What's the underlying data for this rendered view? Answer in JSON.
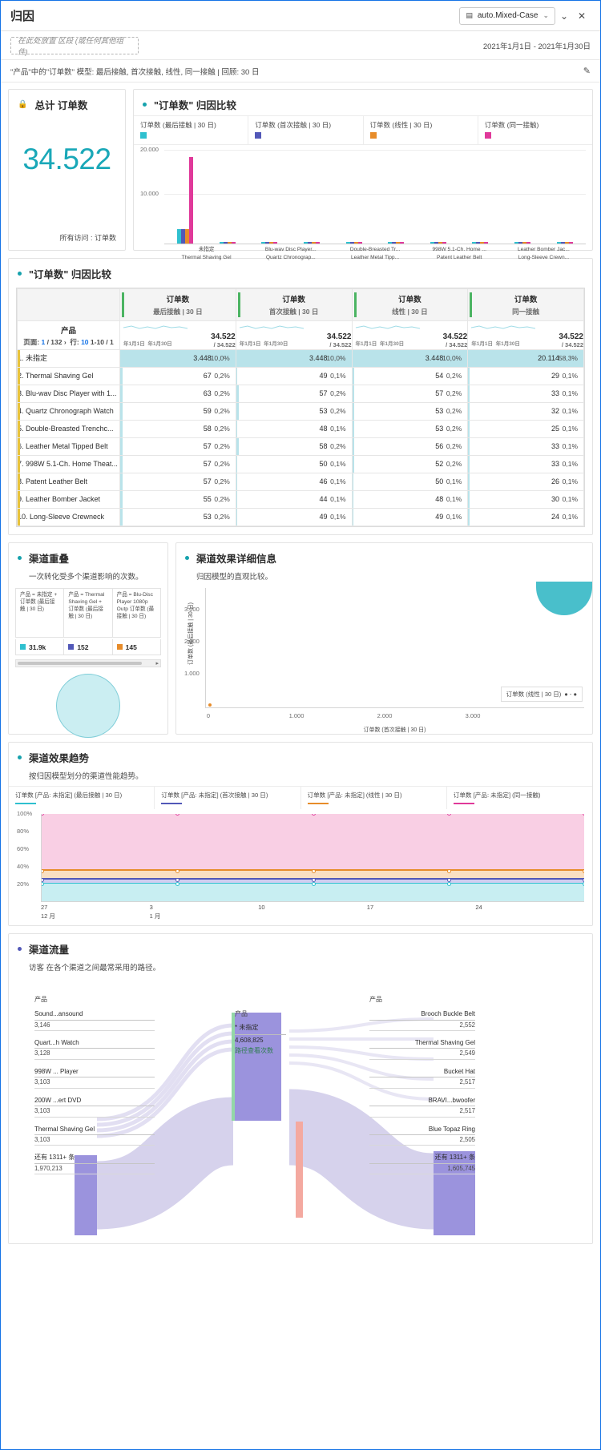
{
  "header": {
    "title": "归因",
    "report_suite": "auto.Mixed-Case",
    "db_icon": "database-icon",
    "chevron": "⌄",
    "close": "✕",
    "dropzone_placeholder": "在此处放置 区段 (或任何其他组件)",
    "date_range": "2021年1月1日 - 2021年1月30日",
    "model_line": "\"产品\"中的\"订单数\" 模型: 最后接触, 首次接触, 线性, 同一接触 | 回顾: 30 日",
    "edit_icon": "pencil-icon"
  },
  "summary": {
    "title": "总计 订单数",
    "lock_icon": "lock-icon",
    "value": "34.522",
    "footer": "所有访问 : 订单数",
    "color": "#1aa8b8"
  },
  "attribution_chart": {
    "title": "\"订单数\" 归因比较",
    "legend": [
      {
        "label": "订单数 (最后接触 | 30 日)",
        "color": "#2fc0cf"
      },
      {
        "label": "订单数 (首次接触 | 30 日)",
        "color": "#5258b8"
      },
      {
        "label": "订单数 (线性 | 30 日)",
        "color": "#e78c2a"
      },
      {
        "label": "订单数 (同一接触)",
        "color": "#e0399a"
      }
    ],
    "chart_data": {
      "type": "bar",
      "title": "\"订单数\" 归因比较",
      "ylabel": "",
      "xlabel": "",
      "ylim": [
        0,
        22000
      ],
      "yticks": [
        "10.000",
        "20.000"
      ],
      "categories": [
        "未指定",
        "Thermal Shaving Gel",
        "Blu-wav Disc Player...",
        "Quartz Chronograp...",
        "Double-Breasted Tr...",
        "Leather Metal Tipp...",
        "998W 5.1-Ch. Home ...",
        "Patent Leather Belt",
        "Leather Bomber Jac...",
        "Long-Sleeve Crewn..."
      ],
      "series": [
        {
          "name": "订单数 (最后接触 | 30 日)",
          "color": "#2fc0cf",
          "values": [
            3448,
            67,
            63,
            59,
            58,
            57,
            57,
            57,
            55,
            53
          ]
        },
        {
          "name": "订单数 (首次接触 | 30 日)",
          "color": "#5258b8",
          "values": [
            3448,
            49,
            57,
            53,
            48,
            58,
            52,
            46,
            44,
            49
          ]
        },
        {
          "name": "订单数 (线性 | 30 日)",
          "color": "#e78c2a",
          "values": [
            3448,
            54,
            57,
            53,
            53,
            56,
            50,
            50,
            48,
            49
          ]
        },
        {
          "name": "订单数 (同一接触)",
          "color": "#e0399a",
          "values": [
            20114,
            29,
            33,
            32,
            25,
            33,
            33,
            26,
            30,
            24
          ]
        }
      ]
    }
  },
  "freeform": {
    "title": "\"订单数\" 归因比较",
    "metric_columns": [
      {
        "metric": "订单数",
        "model": "最后接触 | 30 日",
        "total": "34.522",
        "denominator": "/ 34.522",
        "start": "年1月1日",
        "end": "年1月30日"
      },
      {
        "metric": "订单数",
        "model": "首次接触 | 30 日",
        "total": "34.522",
        "denominator": "/ 34.522",
        "start": "年1月1日",
        "end": "年1月30日"
      },
      {
        "metric": "订单数",
        "model": "线性 | 30 日",
        "total": "34.522",
        "denominator": "/ 34.522",
        "start": "年1月1日",
        "end": "年1月30日"
      },
      {
        "metric": "订单数",
        "model": "同一接触",
        "total": "34.522",
        "denominator": "/ 34.522",
        "start": "年1月1日",
        "end": "年1月30日"
      }
    ],
    "dimension_header": "产品",
    "pagination": {
      "page_label": "页面:",
      "page_current": "1",
      "page_sep": "/",
      "page_total": "132",
      "next": "›",
      "rows_label": "行:",
      "rows_value": "10",
      "range": "1-10 / 1"
    },
    "rows": [
      {
        "name": "1. 未指定",
        "c": [
          {
            "v": "3.448",
            "p": "10,0%",
            "bar": 100
          },
          {
            "v": "3.448",
            "p": "10,0%",
            "bar": 100
          },
          {
            "v": "3.448",
            "p": "10,0%",
            "bar": 100
          },
          {
            "v": "20.114",
            "p": "58,3%",
            "bar": 100
          }
        ]
      },
      {
        "name": "2. Thermal Shaving Gel",
        "c": [
          {
            "v": "67",
            "p": "0,2%",
            "bar": 2
          },
          {
            "v": "49",
            "p": "0,1%",
            "bar": 1
          },
          {
            "v": "54",
            "p": "0,2%",
            "bar": 2
          },
          {
            "v": "29",
            "p": "0,1%",
            "bar": 1
          }
        ]
      },
      {
        "name": "3. Blu-wav Disc Player with 1...",
        "c": [
          {
            "v": "63",
            "p": "0,2%",
            "bar": 2
          },
          {
            "v": "57",
            "p": "0,2%",
            "bar": 2
          },
          {
            "v": "57",
            "p": "0,2%",
            "bar": 2
          },
          {
            "v": "33",
            "p": "0,1%",
            "bar": 1
          }
        ]
      },
      {
        "name": "4. Quartz Chronograph Watch",
        "c": [
          {
            "v": "59",
            "p": "0,2%",
            "bar": 2
          },
          {
            "v": "53",
            "p": "0,2%",
            "bar": 2
          },
          {
            "v": "53",
            "p": "0,2%",
            "bar": 2
          },
          {
            "v": "32",
            "p": "0,1%",
            "bar": 1
          }
        ]
      },
      {
        "name": "5. Double-Breasted Trenchc...",
        "c": [
          {
            "v": "58",
            "p": "0,2%",
            "bar": 2
          },
          {
            "v": "48",
            "p": "0,1%",
            "bar": 1
          },
          {
            "v": "53",
            "p": "0,2%",
            "bar": 2
          },
          {
            "v": "25",
            "p": "0,1%",
            "bar": 1
          }
        ]
      },
      {
        "name": "6. Leather Metal Tipped Belt",
        "c": [
          {
            "v": "57",
            "p": "0,2%",
            "bar": 2
          },
          {
            "v": "58",
            "p": "0,2%",
            "bar": 2
          },
          {
            "v": "56",
            "p": "0,2%",
            "bar": 2
          },
          {
            "v": "33",
            "p": "0,1%",
            "bar": 1
          }
        ]
      },
      {
        "name": "7. 998W 5.1-Ch. Home Theat...",
        "c": [
          {
            "v": "57",
            "p": "0,2%",
            "bar": 2
          },
          {
            "v": "50",
            "p": "0,1%",
            "bar": 1
          },
          {
            "v": "52",
            "p": "0,2%",
            "bar": 2
          },
          {
            "v": "33",
            "p": "0,1%",
            "bar": 1
          }
        ]
      },
      {
        "name": "8. Patent Leather Belt",
        "c": [
          {
            "v": "57",
            "p": "0,2%",
            "bar": 2
          },
          {
            "v": "46",
            "p": "0,1%",
            "bar": 1
          },
          {
            "v": "50",
            "p": "0,1%",
            "bar": 1
          },
          {
            "v": "26",
            "p": "0,1%",
            "bar": 1
          }
        ]
      },
      {
        "name": "9. Leather Bomber Jacket",
        "c": [
          {
            "v": "55",
            "p": "0,2%",
            "bar": 2
          },
          {
            "v": "44",
            "p": "0,1%",
            "bar": 1
          },
          {
            "v": "48",
            "p": "0,1%",
            "bar": 1
          },
          {
            "v": "30",
            "p": "0,1%",
            "bar": 1
          }
        ]
      },
      {
        "name": "10. Long-Sleeve Crewneck",
        "c": [
          {
            "v": "53",
            "p": "0,2%",
            "bar": 2
          },
          {
            "v": "49",
            "p": "0,1%",
            "bar": 1
          },
          {
            "v": "49",
            "p": "0,1%",
            "bar": 1
          },
          {
            "v": "24",
            "p": "0,1%",
            "bar": 1
          }
        ]
      }
    ]
  },
  "overlap": {
    "title": "渠道重叠",
    "subtitle": "一次转化受多个渠道影响的次数。",
    "columns": [
      {
        "label": "产品 = 未指定 + 订单数 (最后接触 | 30 日)",
        "value": "31.9k",
        "color": "#2fc0cf"
      },
      {
        "label": "产品 = Thermal Shaving Gel + 订单数 (最后接触 | 30 日)",
        "value": "152",
        "color": "#5258b8"
      },
      {
        "label": "产品 = Blu-Disc Player 1080p Outp 订单数 (最接触 | 30 日)",
        "value": "145",
        "color": "#e78c2a"
      }
    ],
    "scroll_arrow": "▸"
  },
  "detail": {
    "title": "渠道效果详细信息",
    "subtitle": "归因模型的直观比较。",
    "chart_data": {
      "type": "scatter",
      "xlabel": "订单数 (首次接触 | 30 日)",
      "ylabel": "订单数 (最后接触 | 30 日)",
      "xticks": [
        "0",
        "1.000",
        "2.000",
        "3.000"
      ],
      "yticks": [
        "1.000",
        "2.000",
        "3.000"
      ],
      "xlim": [
        0,
        3600
      ],
      "ylim": [
        0,
        3600
      ],
      "points": [
        {
          "x": 60,
          "y": 50,
          "color": "#e78c2a"
        },
        {
          "x": 3448,
          "y": 3448,
          "color": "#49bfcb"
        }
      ],
      "legend": "订单数 (线性 | 30 日)",
      "legend_marks": "● - ●"
    }
  },
  "trend": {
    "title": "渠道效果趋势",
    "subtitle": "按归因模型划分的渠道性能趋势。",
    "legend": [
      {
        "label": "订单数 [产品: 未指定] (最后接触 | 30 日)",
        "color": "#2fc0cf"
      },
      {
        "label": "订单数 [产品: 未指定] (首次接触 | 30 日)",
        "color": "#5258b8"
      },
      {
        "label": "订单数 [产品: 未指定] (线性 | 30 日)",
        "color": "#e78c2a"
      },
      {
        "label": "订单数 [产品: 未指定] (同一接触)",
        "color": "#e0399a"
      }
    ],
    "chart_data": {
      "type": "area",
      "yticks": [
        "20%",
        "40%",
        "60%",
        "80%",
        "100%"
      ],
      "ylim": [
        0,
        100
      ],
      "xticks": [
        {
          "top": "27",
          "bottom": "12 月"
        },
        {
          "top": "3",
          "bottom": "1 月"
        },
        {
          "top": "10",
          "bottom": ""
        },
        {
          "top": "17",
          "bottom": ""
        },
        {
          "top": "24",
          "bottom": ""
        }
      ],
      "series": [
        {
          "name": "订单数 [产品: 未指定] (最后接触 | 30 日)",
          "color": "#2fc0cf",
          "values": [
            20,
            20,
            20,
            20,
            20
          ]
        },
        {
          "name": "订单数 [产品: 未指定] (首次接触 | 30 日)",
          "color": "#5258b8",
          "values": [
            25,
            25,
            25,
            25,
            25
          ]
        },
        {
          "name": "订单数 [产品: 未指定] (线性 | 30 日)",
          "color": "#e78c2a",
          "values": [
            35,
            35,
            35,
            35,
            35
          ]
        },
        {
          "name": "订单数 [产品: 未指定] (同一接触)",
          "color": "#e0399a",
          "values": [
            100,
            100,
            100,
            100,
            100
          ]
        }
      ]
    }
  },
  "flow": {
    "title": "渠道流量",
    "subtitle": "访客 在各个渠道之间最常采用的路径。",
    "columns": [
      {
        "header": "产品",
        "items": [
          {
            "label": "Sound...ansound",
            "value": "3,146"
          },
          {
            "label": "Quart...h Watch",
            "value": "3,128"
          },
          {
            "label": "998W ... Player",
            "value": "3,103"
          },
          {
            "label": "200W ...ert DVD",
            "value": "3,103"
          },
          {
            "label": "Thermal Shaving Gel",
            "value": "3,103"
          },
          {
            "label": "还有 1311+ 条",
            "value": "1,970,213"
          }
        ]
      },
      {
        "header": "产品",
        "items": [
          {
            "label": "* 未指定",
            "value": "4,608,825",
            "sub": "路径查看次数"
          }
        ]
      },
      {
        "header": "产品",
        "items": [
          {
            "label": "Brooch Buckle Belt",
            "value": "2,552"
          },
          {
            "label": "Thermal Shaving Gel",
            "value": "2,549"
          },
          {
            "label": "Bucket Hat",
            "value": "2,517"
          },
          {
            "label": "BRAVI...bwoofer",
            "value": "2,517"
          },
          {
            "label": "Blue Topaz Ring",
            "value": "2,505"
          },
          {
            "label": "还有 1311+ 条",
            "value": "1,605,745"
          }
        ]
      }
    ]
  }
}
